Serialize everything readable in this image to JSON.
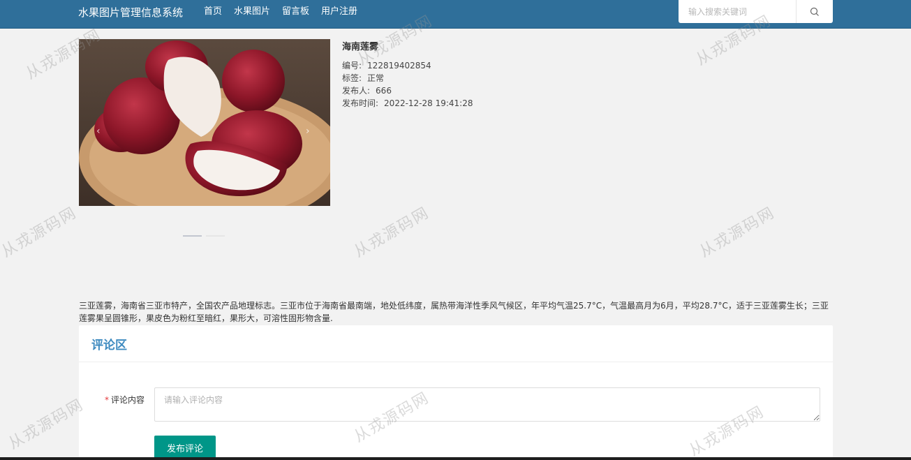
{
  "header": {
    "brand": "水果图片管理信息系统",
    "nav": [
      {
        "label": "首页"
      },
      {
        "label": "水果图片"
      },
      {
        "label": "留言板"
      },
      {
        "label": "用户注册"
      }
    ],
    "search": {
      "placeholder": "输入搜索关键词",
      "value": ""
    }
  },
  "product": {
    "title": "海南莲雾",
    "fields": [
      {
        "label": "编号:",
        "value": "122819402854"
      },
      {
        "label": "标签:",
        "value": "正常"
      },
      {
        "label": "发布人:",
        "value": "666"
      },
      {
        "label": "发布时间:",
        "value": "2022-12-28 19:41:28"
      }
    ],
    "carousel": {
      "prev": "‹",
      "next": "›",
      "slides": 2,
      "active": 0
    },
    "description": "三亚莲雾，海南省三亚市特产，全国农产品地理标志。三亚市位于海南省最南端，地处低纬度，属热带海洋性季风气候区，年平均气温25.7°C，气温最高月为6月，平均28.7°C，适于三亚莲雾生长；三亚莲雾果呈圆锥形，果皮色为粉红至暗红，果形大，可溶性固形物含量."
  },
  "comments": {
    "title": "评论区",
    "required_mark": "*",
    "label": "评论内容",
    "placeholder": "请输入评论内容",
    "value": "",
    "submit": "发布评论"
  },
  "watermark": "从戎源码网",
  "colors": {
    "topbar": "#2f6f9a",
    "accent": "#3f8bc0",
    "button": "#009688"
  },
  "icons": {
    "search": "search-icon"
  }
}
